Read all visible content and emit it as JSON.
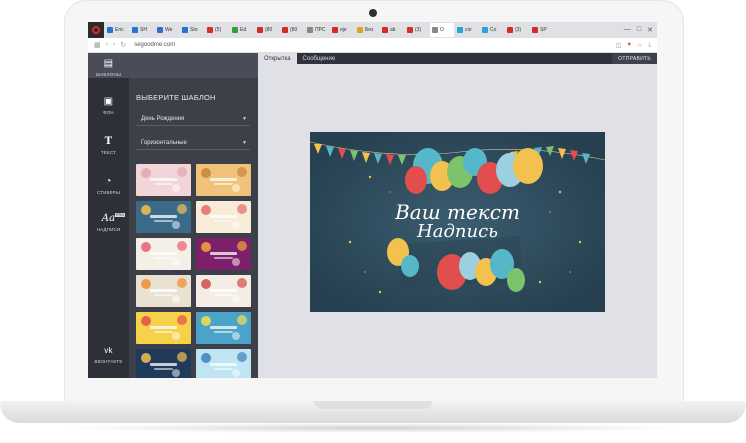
{
  "browser": {
    "tabs": [
      {
        "label": "Eric",
        "color": "#2b6fd1"
      },
      {
        "label": "SH",
        "color": "#2b6fd1"
      },
      {
        "label": "We",
        "color": "#2b6fd1"
      },
      {
        "label": "Sto",
        "color": "#2b6fd1"
      },
      {
        "label": "(5)",
        "color": "#d62b2b"
      },
      {
        "label": "Ed",
        "color": "#3a9a3a"
      },
      {
        "label": "(80",
        "color": "#d62b2b"
      },
      {
        "label": "(80",
        "color": "#d62b2b"
      },
      {
        "label": "ПРС",
        "color": "#888888"
      },
      {
        "label": "eje",
        "color": "#d62b2b"
      },
      {
        "label": "Без",
        "color": "#e0a020"
      },
      {
        "label": "ab",
        "color": "#d62b2b"
      },
      {
        "label": "(3)",
        "color": "#d62b2b"
      },
      {
        "label": "O",
        "color": "#888888"
      },
      {
        "label": "cor",
        "color": "#2aa3d6"
      },
      {
        "label": "Co",
        "color": "#2aa3d6"
      },
      {
        "label": "(3)",
        "color": "#d62b2b"
      },
      {
        "label": "SP",
        "color": "#d62b2b"
      }
    ],
    "active_tab_index": 13,
    "url": "segoodme.com",
    "window_controls": [
      "—",
      "□",
      "✕"
    ]
  },
  "sidebar": {
    "items": [
      {
        "label": "ШАБЛОНЫ",
        "icon": "template-icon",
        "glyph": "▤"
      },
      {
        "label": "ФОН",
        "icon": "background-icon",
        "glyph": "▣"
      },
      {
        "label": "ТЕКСТ",
        "icon": "text-icon",
        "glyph": "T"
      },
      {
        "label": "СТИКЕРЫ",
        "icon": "sticker-icon",
        "glyph": "◔"
      },
      {
        "label": "НАДПИСИ",
        "icon": "lettering-icon",
        "glyph": "Aa",
        "badge": "PRO"
      }
    ],
    "vk_label": "ВКОНТАКТЕ",
    "vk_glyph": "vk"
  },
  "panel": {
    "title": "ВЫБЕРИТЕ ШАБЛОН",
    "category": "День Рождения",
    "orientation": "Горизонтальные",
    "thumbs": [
      {
        "bg": "#f1d5d8",
        "accent": "#e0a7b0"
      },
      {
        "bg": "#f0c27a",
        "accent": "#c8843a"
      },
      {
        "bg": "#3b6b88",
        "accent": "#f2c14e"
      },
      {
        "bg": "#f6ecd8",
        "accent": "#e56b6b"
      },
      {
        "bg": "#f4f0e8",
        "accent": "#e85d75"
      },
      {
        "bg": "#7e1f6a",
        "accent": "#f4a83c"
      },
      {
        "bg": "#e9e2d3",
        "accent": "#f28c28"
      },
      {
        "bg": "#f3ede6",
        "accent": "#d44a4a"
      },
      {
        "bg": "#f6d24a",
        "accent": "#e24d4d"
      },
      {
        "bg": "#4aa3c8",
        "accent": "#f4e04a"
      },
      {
        "bg": "#1f3a5a",
        "accent": "#f2c14e"
      },
      {
        "bg": "#bfe4f2",
        "accent": "#3f7fbf"
      }
    ]
  },
  "main": {
    "tabs": [
      "Открытка",
      "Сообщение"
    ],
    "send_label": "ОТПРАВИТЬ",
    "card": {
      "line1": "Ваш текст",
      "line2": "Надпись",
      "bg": "#2f4d5e"
    }
  }
}
